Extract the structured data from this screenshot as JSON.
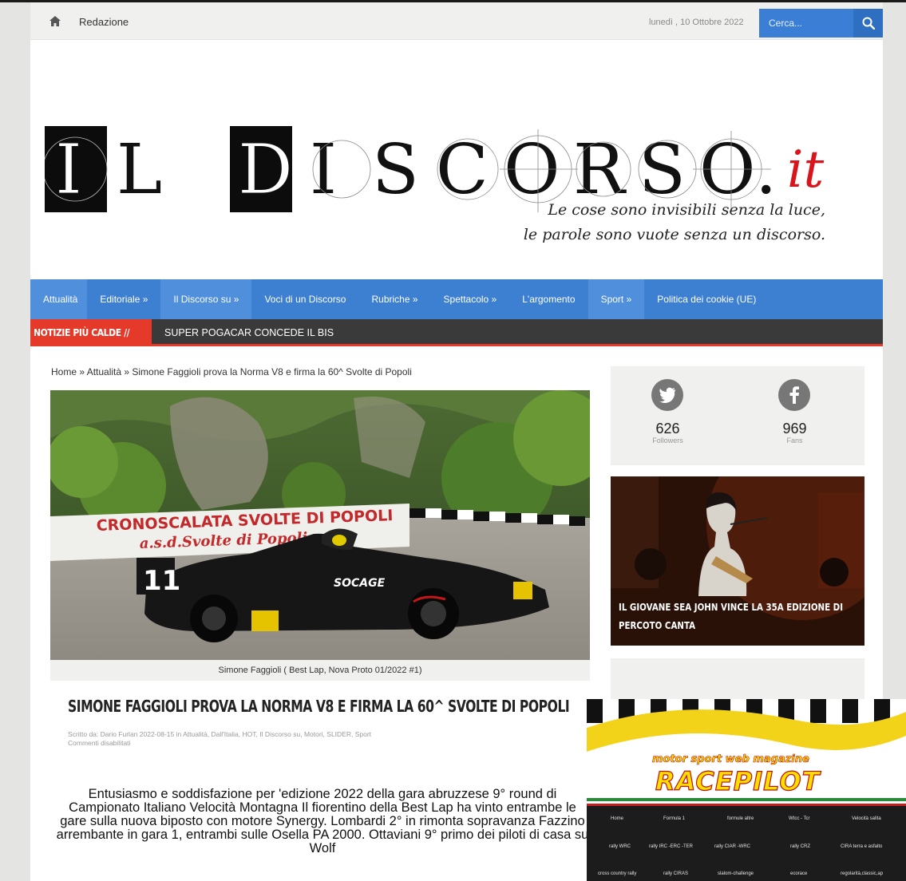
{
  "topbar": {
    "home_label": "Redazione",
    "date": "lunedì , 10 Ottobre 2022",
    "search_placeholder": "Cerca..."
  },
  "logo": {
    "letters_left": [
      "I",
      "L"
    ],
    "letters_right": [
      "D",
      "I",
      "S",
      "C",
      "O",
      "R",
      "S",
      "O"
    ],
    "dot": ".",
    "suffix": "it"
  },
  "tagline": {
    "line1": "Le cose sono invisibili senza la luce,",
    "line2": "le parole sono vuote senza un discorso."
  },
  "nav": [
    {
      "label": "Attualità",
      "active": true
    },
    {
      "label": "Editoriale »",
      "active": false
    },
    {
      "label": "Il Discorso su »",
      "active": true
    },
    {
      "label": "Voci di un Discorso",
      "active": false
    },
    {
      "label": "Rubriche »",
      "active": false
    },
    {
      "label": "Spettacolo »",
      "active": false
    },
    {
      "label": "L'argomento",
      "active": false
    },
    {
      "label": "Sport »",
      "active": true
    },
    {
      "label": "Politica dei cookie (UE)",
      "active": false
    }
  ],
  "ticker": {
    "label": "NOTIZIE PIÙ CALDE //",
    "headline": "SUPER POGACAR CONCEDE IL BIS"
  },
  "breadcrumb": "Home » Attualità » Simone Faggioli prova la Norma V8 e firma la 60^ Svolte di Popoli",
  "article": {
    "image": {
      "banner_line1": "CRONOSCALATA SVOLTE DI POPOLI",
      "banner_line2": "a.s.d.Svolte di Popoli",
      "car_number": "11",
      "car_sponsor": "SOCAGE"
    },
    "caption": "Simone Faggioli ( Best Lap, Nova Proto 01/2022 #1)",
    "title": "SIMONE FAGGIOLI PROVA LA NORMA V8 E FIRMA LA 60^ SVOLTE DI POPOLI",
    "meta_line1": "Scritto da: Dario Furlan   2022-08-15   in Attualità, Dall'Italia, HOT, Il Discorso su, Motori, SLIDER, Sport",
    "meta_line2": "Commenti disabilitati",
    "lead": "Entusiasmo e soddisfazione per 'edizione 2022 della gara abruzzese 9° round di Campionato Italiano Velocità Montagna Il fiorentino della Best Lap ha vinto entrambe le gare sulla nuova biposto con motore Synergy. Lombardi 2° in rimonta sopravanza Fazzino arrembante in gara 1, entrambi sulle Osella PA 2000. Ottaviani 9° primo dei piloti di casa su Wolf"
  },
  "social": {
    "twitter": {
      "count": "626",
      "label": "Followers",
      "icon": "twitter-icon",
      "color": "#777777"
    },
    "facebook": {
      "count": "969",
      "label": "Fans",
      "icon": "facebook-icon",
      "color": "#777777"
    }
  },
  "promo": {
    "title": "IL GIOVANE SEA JOHN VINCE LA 35A EDIZIONE DI PERCOTO CANTA"
  },
  "ad": {
    "tagline": "motor sport web magazine",
    "brand": "RACEPILOT",
    "menu": [
      [
        "Home",
        "Formula 1",
        "formule altre",
        "Wtcc - Tcr",
        "Velocità salita"
      ],
      [
        "rally WRC",
        "rally IRC -ERC -TER",
        "rally CIAR -WRC",
        "rally CRZ",
        "CIRA terra e asfalto"
      ],
      [
        "cross country rally",
        "rally CIRAS",
        "slalom-challenge",
        "ecorace",
        "regolarità,classic,ap"
      ]
    ]
  },
  "colors": {
    "nav_blue": "#3d7fd0",
    "ticker_red": "#e53a29",
    "logo_accent": "#d8141c"
  }
}
